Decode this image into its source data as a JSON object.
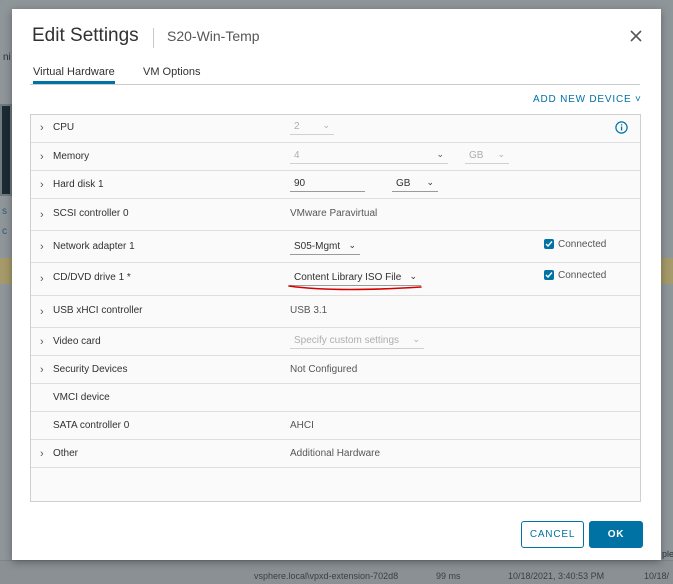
{
  "dialog": {
    "title": "Edit Settings",
    "subtitle": "S20-Win-Temp",
    "tabs": [
      {
        "label": "Virtual Hardware",
        "active": true
      },
      {
        "label": "VM Options",
        "active": false
      }
    ],
    "add_device_label": "ADD NEW DEVICE ˅",
    "buttons": {
      "cancel": "CANCEL",
      "ok": "OK"
    }
  },
  "hardware": {
    "cpu": {
      "label": "CPU",
      "value": "2"
    },
    "memory": {
      "label": "Memory",
      "value": "4",
      "unit": "GB"
    },
    "hard_disk": {
      "label": "Hard disk 1",
      "value": "90",
      "unit": "GB"
    },
    "scsi": {
      "label": "SCSI controller 0",
      "value": "VMware Paravirtual"
    },
    "network": {
      "label": "Network adapter 1",
      "value": "S05-Mgmt",
      "status": "Connected",
      "connected": true
    },
    "cddvd": {
      "label": "CD/DVD drive 1 *",
      "value": "Content Library ISO File",
      "status": "Connected",
      "connected": true
    },
    "usb": {
      "label": "USB xHCI controller",
      "value": "USB 3.1"
    },
    "video": {
      "label": "Video card",
      "value": "Specify custom settings"
    },
    "security": {
      "label": "Security Devices",
      "value": "Not Configured"
    },
    "vmci": {
      "label": "VMCI device"
    },
    "sata": {
      "label": "SATA controller 0",
      "value": "AHCI"
    },
    "other": {
      "label": "Other",
      "value": "Additional Hardware"
    }
  },
  "background": {
    "bottom_row": [
      "vsphere.local\\vpxd-extension-702d8",
      "99 ms",
      "10/18/2021, 3:40:53 PM",
      "10/18/"
    ],
    "side_fragments": [
      "ni",
      "s",
      "c",
      "ple"
    ]
  },
  "colors": {
    "accent": "#0072a3",
    "annotation": "#d40000"
  }
}
